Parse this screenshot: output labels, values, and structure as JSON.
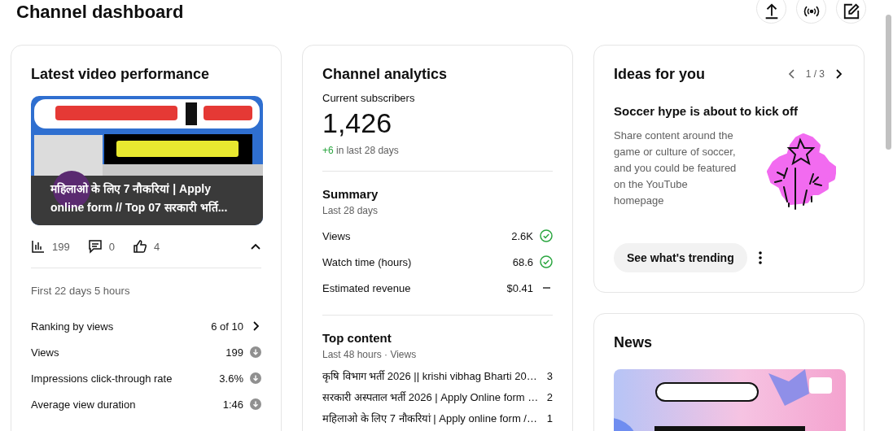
{
  "page_title": "Channel dashboard",
  "latest_video": {
    "title": "Latest video performance",
    "video_title": "महिलाओ के लिए 7 नौकरियां | Apply online form // Top 07 सरकारी भर्ति...",
    "stats": [
      {
        "kind": "views",
        "value": "199"
      },
      {
        "kind": "comments",
        "value": "0"
      },
      {
        "kind": "likes",
        "value": "4"
      }
    ],
    "expanded": true,
    "period": "First 22 days 5 hours",
    "metrics": [
      {
        "kind": "ranking",
        "label": "Ranking by views",
        "value": "6 of 10"
      },
      {
        "kind": "below",
        "label": "Views",
        "value": "199"
      },
      {
        "kind": "below",
        "label": "Impressions click-through rate",
        "value": "3.6%"
      },
      {
        "kind": "below",
        "label": "Average view duration",
        "value": "1:46"
      }
    ]
  },
  "channel_analytics": {
    "title": "Channel analytics",
    "subscribers_label": "Current subscribers",
    "subscribers": "1,426",
    "change": "+6",
    "change_period": "in last 28 days",
    "summary": {
      "title": "Summary",
      "period": "Last 28 days",
      "rows": [
        {
          "kind": "check",
          "label": "Views",
          "value": "2.6K"
        },
        {
          "kind": "check",
          "label": "Watch time (hours)",
          "value": "68.6"
        },
        {
          "kind": "dash",
          "label": "Estimated revenue",
          "value": "$0.41"
        }
      ]
    },
    "top_content": {
      "title": "Top content",
      "period": "Last 48 hours · Views",
      "rows": [
        {
          "title": "कृषि विभाग भर्ती 2026 || krishi vibhag Bharti 20…",
          "views": "3"
        },
        {
          "title": "सरकारी अस्पताल भर्ती 2026 | Apply Online form …",
          "views": "2"
        },
        {
          "title": "महिलाओ के लिए 7 नौकरियां | Apply online form /…",
          "views": "1"
        }
      ]
    }
  },
  "ideas": {
    "title": "Ideas for you",
    "pager": "1 / 3",
    "heading": "Soccer hype is about to kick off",
    "body": "Share content around the game or culture of soccer, and you could be featured on the YouTube homepage",
    "button": "See what's trending"
  },
  "news": {
    "title": "News"
  }
}
